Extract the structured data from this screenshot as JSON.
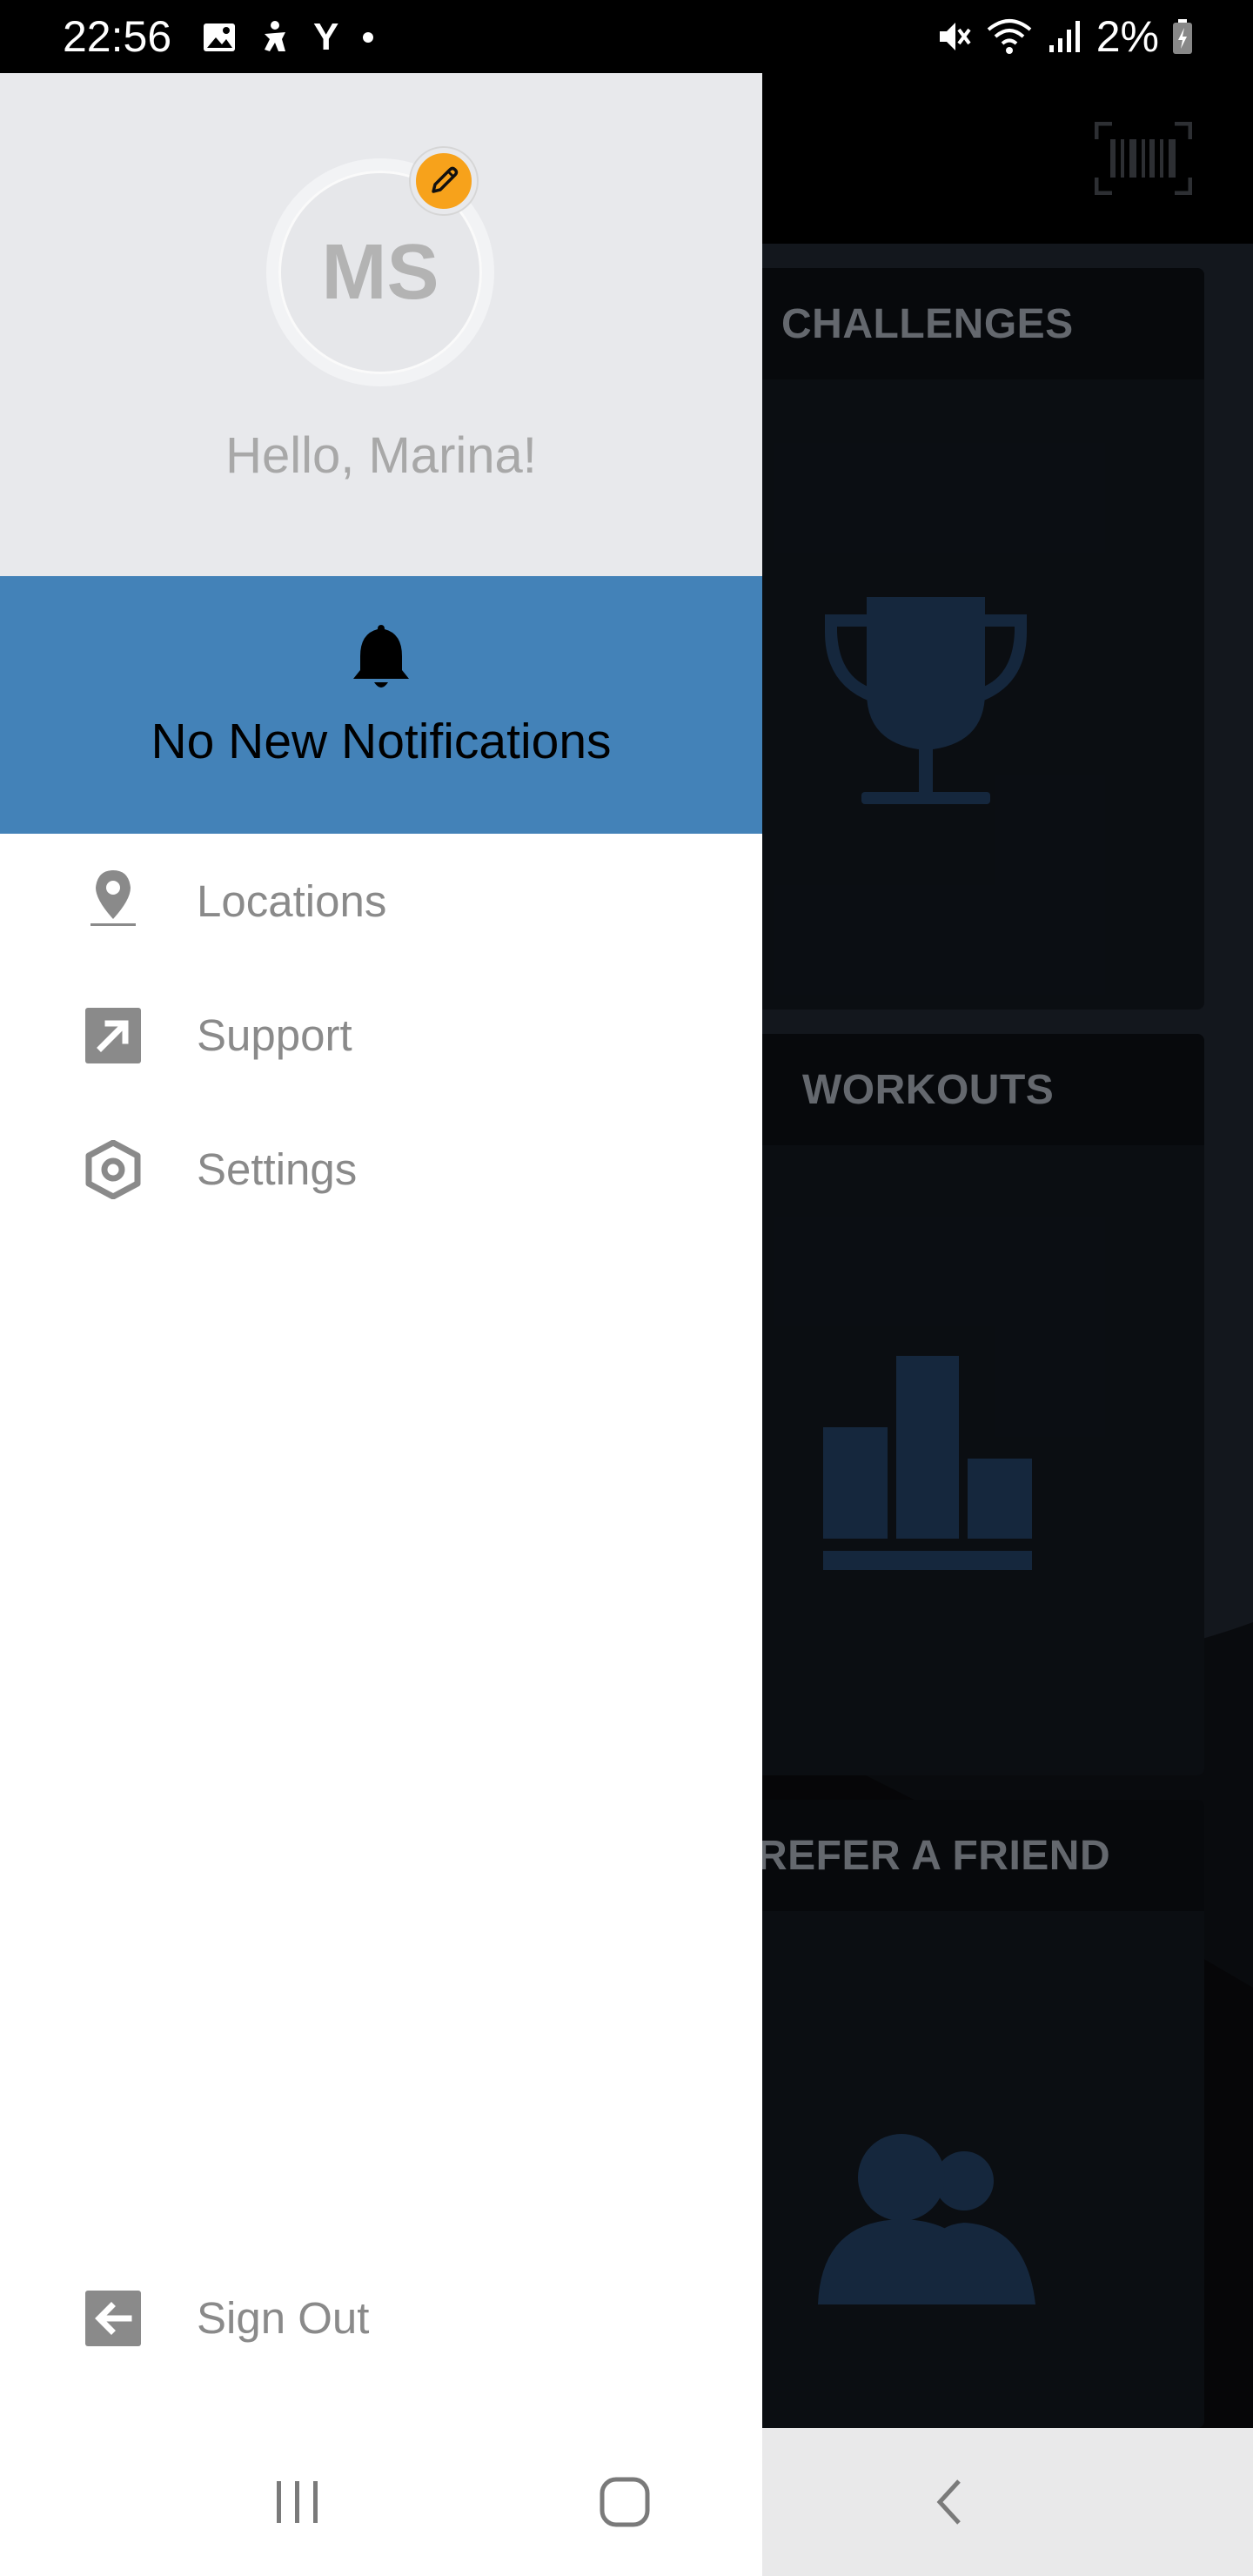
{
  "status_bar": {
    "time": "22:56",
    "battery": "2%",
    "left_icons": [
      "image-icon",
      "accessibility-icon",
      "y-app-icon",
      "dot-icon"
    ],
    "right_icons": [
      "mute-icon",
      "wifi-icon",
      "signal-icon",
      "battery-charging-icon"
    ],
    "y_glyph": "Y"
  },
  "drawer": {
    "avatar_initials": "MS",
    "greeting": "Hello, Marina!",
    "notifications_text": "No New Notifications",
    "items": [
      {
        "label": "Locations",
        "icon": "location-pin-icon"
      },
      {
        "label": "Support",
        "icon": "external-link-icon"
      },
      {
        "label": "Settings",
        "icon": "settings-hexagon-icon"
      }
    ],
    "sign_out": {
      "label": "Sign Out",
      "icon": "sign-out-icon"
    },
    "colors": {
      "header_bg": "#e8e9ec",
      "notif_bg": "#4382b8",
      "edit_badge": "#f7a21b",
      "item_text": "#8a8a8a"
    }
  },
  "background_app": {
    "cards": [
      {
        "title": "CHALLENGES",
        "icon": "trophy-icon"
      },
      {
        "title": "WORKOUTS",
        "icon": "bar-chart-icon"
      },
      {
        "title": "REFER A FRIEND",
        "icon": "people-icon"
      }
    ],
    "top_right_icon": "barcode-icon",
    "accent_icon_color": "#1d3552"
  },
  "nav_bar": {
    "buttons": [
      "recent-apps-icon",
      "home-icon",
      "back-icon"
    ]
  }
}
